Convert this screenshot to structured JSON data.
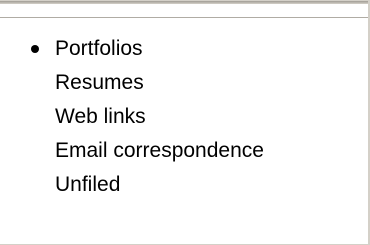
{
  "menu": {
    "items": [
      {
        "label": "Portfolios",
        "selected": true
      },
      {
        "label": "Resumes",
        "selected": false
      },
      {
        "label": "Web links",
        "selected": false
      },
      {
        "label": "Email correspondence",
        "selected": false
      },
      {
        "label": "Unfiled",
        "selected": false
      }
    ]
  },
  "colors": {
    "background": "#ffffff",
    "chrome": "#d4d0c8",
    "text": "#000000"
  },
  "icons": {
    "selected_marker": "radio-bullet-icon"
  }
}
